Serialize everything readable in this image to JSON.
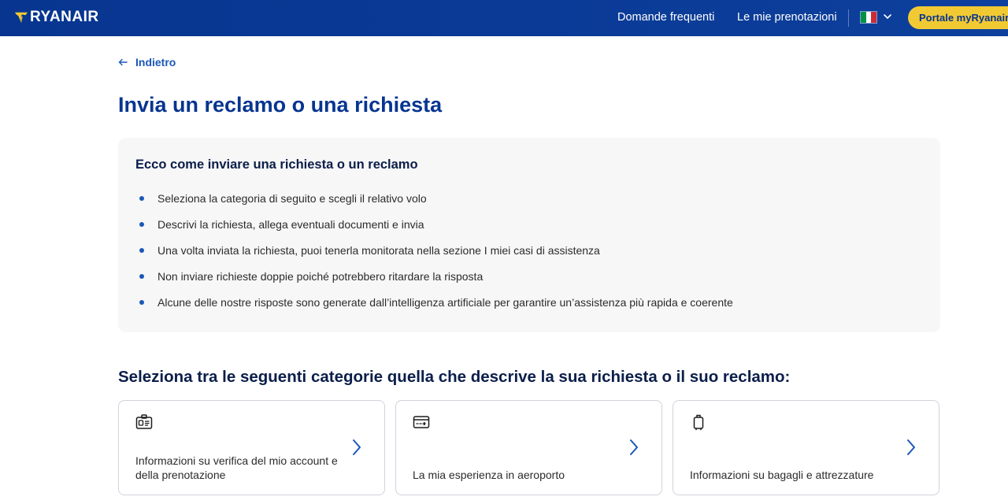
{
  "header": {
    "brand": "RYANAIR",
    "nav": {
      "faq": "Domande frequenti",
      "bookings": "Le mie prenotazioni"
    },
    "portal_button": "Portale myRyanair",
    "colors": {
      "bar": "#073590",
      "accent": "#f1c933"
    }
  },
  "back": {
    "label": "Indietro",
    "icon": "arrow-left-icon"
  },
  "page_title": "Invia un reclamo o una richiesta",
  "info": {
    "title": "Ecco come inviare una richiesta o un reclamo",
    "items": [
      "Seleziona la categoria di seguito e scegli il relativo volo",
      "Descrivi la richiesta, allega eventuali documenti e invia",
      "Una volta inviata la richiesta, puoi tenerla monitorata nella sezione I miei casi di assistenza",
      "Non inviare richieste doppie poiché potrebbero ritardare la risposta",
      "Alcune delle nostre risposte sono generate dall’intelligenza artificiale per garantire un’assistenza più rapida e coerente"
    ]
  },
  "categories": {
    "title": "Seleziona tra le seguenti categorie quella che descrive la sua richiesta o il suo reclamo:",
    "cards": [
      {
        "label": "Informazioni su verifica del mio account e della prenotazione",
        "icon": "id-card-icon"
      },
      {
        "label": "La mia esperienza in aeroporto",
        "icon": "boarding-pass-icon"
      },
      {
        "label": "Informazioni su bagagli e attrezzature",
        "icon": "luggage-icon"
      }
    ]
  }
}
